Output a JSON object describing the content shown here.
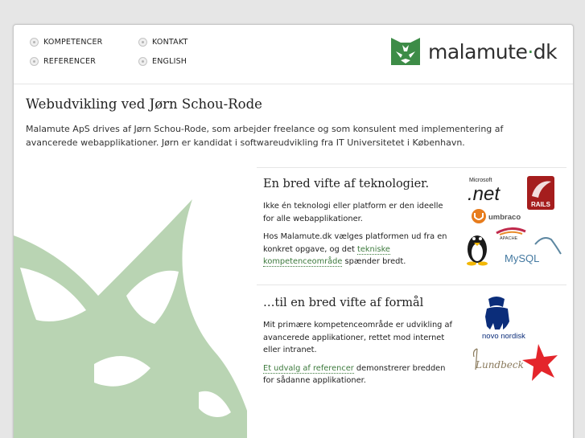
{
  "nav": {
    "items": [
      {
        "label": "KOMPETENCER"
      },
      {
        "label": "KONTAKT"
      },
      {
        "label": "REFERENCER"
      },
      {
        "label": "ENGLISH"
      }
    ]
  },
  "logo": {
    "name": "malamute",
    "dot": "·",
    "tld": "dk"
  },
  "main": {
    "title": "Webudvikling ved Jørn Schou-Rode",
    "intro": "Malamute ApS drives af Jørn Schou-Rode, som arbejder freelance og som konsulent med implementering af avancerede webapplikationer. Jørn er kandidat i softwareudvikling fra IT Universitetet i København."
  },
  "section1": {
    "title": "En bred vifte af teknologier.",
    "p1": "Ikke én teknologi eller platform er den ideelle for alle webapplikationer.",
    "p2_before": "Hos Malamute.dk vælges platformen ud fra en konkret opgave, og det ",
    "p2_link": "tekniske kompetenceområde",
    "p2_after": " spænder bredt.",
    "logos": {
      "microsoft": "Microsoft",
      "net": ".net",
      "rails": "RAILS",
      "umbraco": "umbraco",
      "apache": "APACHE",
      "mysql": "MySQL"
    }
  },
  "section2": {
    "title": "…til en bred vifte af formål",
    "p1": "Mit primære kompetenceområde er udvikling af avancerede applikationer, rettet mod internet eller intranet.",
    "p2_link": "Et udvalg af referencer",
    "p2_after": " demonstrerer bredden for sådanne applikationer.",
    "logos": {
      "novo": "novo nordisk",
      "lundbeck": "Lundbeck"
    }
  },
  "colors": {
    "brand_green": "#3d8c47",
    "deco_green": "#b9d4b3",
    "link": "#3d7a3d"
  }
}
